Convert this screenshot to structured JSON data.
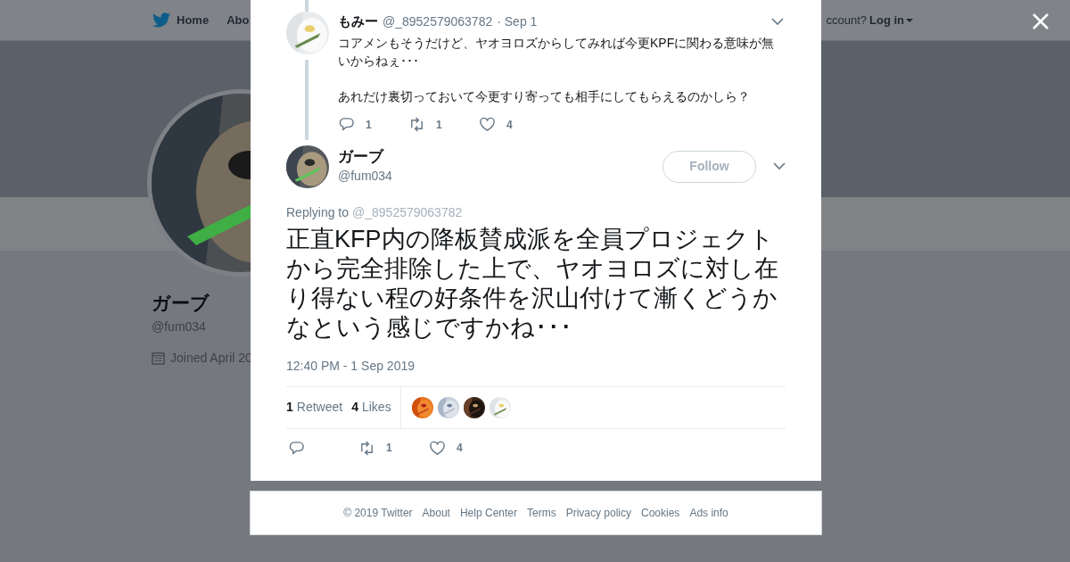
{
  "background_page": {
    "nav": [
      {
        "label": "Home"
      },
      {
        "label": "Abo"
      }
    ],
    "login_prompt": "ccount?",
    "login": "Log in",
    "profile": {
      "name": "ガーブ",
      "handle": "@fum034",
      "joined": "Joined April 20"
    }
  },
  "modal": {
    "parent_tweet": {
      "name": "もみー",
      "handle": "@_8952579063782",
      "date": "· Sep 1",
      "paragraphs": [
        "コアメンもそうだけど、ヤオヨロズからしてみれば今更KPFに関わる意味が無いからねぇ･･･",
        "あれだけ裏切っておいて今更すり寄っても相手にしてもらえるのかしら？"
      ],
      "replies": "1",
      "retweets": "1",
      "likes": "4"
    },
    "tweet": {
      "name": "ガーブ",
      "handle": "@fum034",
      "follow": "Follow",
      "replying_label": "Replying to",
      "replying_handle": "@_8952579063782",
      "text": "正直KFP内の降板賛成派を全員プロジェクトから完全排除した上で、ヤオヨロズに対し在り得ない程の好条件を沢山付けて漸くどうかなという感じですかね･･･",
      "timestamp": "12:40 PM - 1 Sep 2019",
      "retweet_count": "1",
      "retweet_label": "Retweet",
      "like_count": "4",
      "like_label": "Likes",
      "retweets": "1",
      "likes": "4"
    }
  },
  "footer": [
    "© 2019 Twitter",
    "About",
    "Help Center",
    "Terms",
    "Privacy policy",
    "Cookies",
    "Ads info"
  ]
}
